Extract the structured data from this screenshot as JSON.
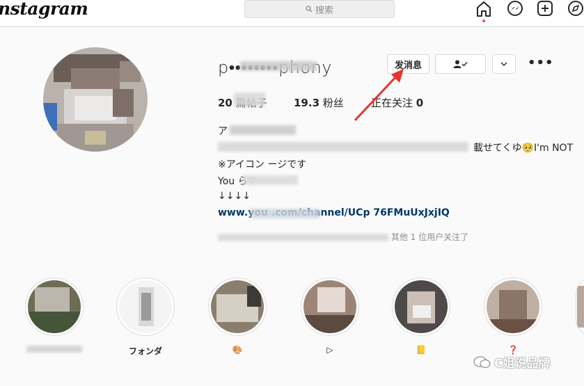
{
  "app": {
    "logo": "nstagram"
  },
  "search": {
    "placeholder": "搜索"
  },
  "nav": {
    "icons": [
      "home-icon",
      "messenger-icon",
      "new-post-icon",
      "explore-icon"
    ]
  },
  "profile": {
    "username": "p••••••••phony",
    "message_button": "发消息",
    "stats": {
      "posts_value": "20",
      "posts_label": "篇帖子",
      "followers_value": "19.3",
      "followers_label": "粉丝",
      "following_label": "正在关注",
      "following_value": "0"
    },
    "bio": {
      "line1": "ア",
      "line2_end": "載せてくゆ🥺I'm NOT",
      "line3": "※アイコン ージです",
      "line4": "You ら♡",
      "line5": "↓↓↓↓",
      "link": "www.you .com/channel/UCp 76FMuUxJxjIQ"
    },
    "followed_by": "其他 1 位用户关注了"
  },
  "highlights": [
    {
      "label": ""
    },
    {
      "label": "フォンダ"
    },
    {
      "label": "🎨"
    },
    {
      "label": "▷"
    },
    {
      "label": "📒"
    },
    {
      "label": "❓"
    }
  ],
  "watermark": {
    "text": "C姐说品牌"
  },
  "colors": {
    "accent_link": "#00376b",
    "notification_dot": "#ed4956",
    "arrow": "#e8322f"
  }
}
